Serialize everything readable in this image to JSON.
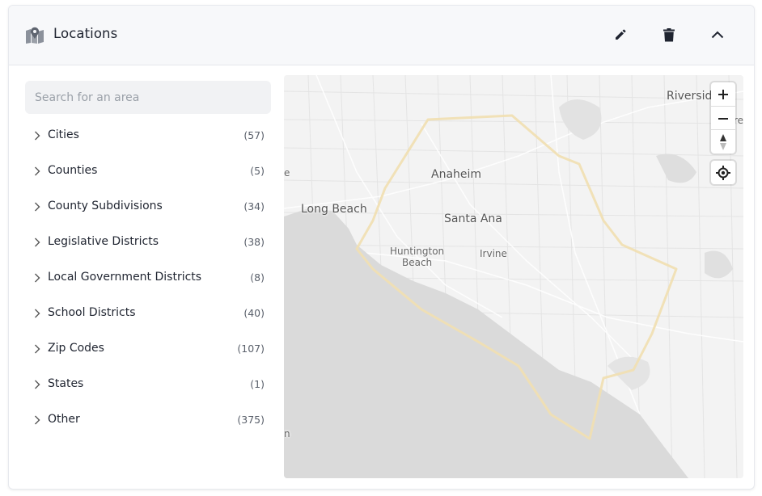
{
  "header": {
    "title": "Locations",
    "icon": "map-pin-icon",
    "actions": [
      "edit-icon",
      "trash-icon",
      "chevron-up-icon"
    ]
  },
  "search": {
    "placeholder": "Search for an area",
    "value": ""
  },
  "categories": [
    {
      "label": "Cities",
      "count": "(57)"
    },
    {
      "label": "Counties",
      "count": "(5)"
    },
    {
      "label": "County Subdivisions",
      "count": "(34)"
    },
    {
      "label": "Legislative Districts",
      "count": "(38)"
    },
    {
      "label": "Local Government Districts",
      "count": "(8)"
    },
    {
      "label": "School Districts",
      "count": "(40)"
    },
    {
      "label": "Zip Codes",
      "count": "(107)"
    },
    {
      "label": "States",
      "count": "(1)"
    },
    {
      "label": "Other",
      "count": "(375)"
    }
  ],
  "map": {
    "labels": {
      "riverside": "Riversid",
      "anaheim": "Anaheim",
      "long_beach": "Long Beach",
      "santa_ana": "Santa Ana",
      "huntington_beach_1": "Huntington",
      "huntington_beach_2": "Beach",
      "irvine": "Irvine",
      "edge_e": "e",
      "edge_re": "re",
      "edge_n": "n"
    },
    "controls": {
      "zoom_in": "+",
      "zoom_out": "−"
    },
    "boundary_color": "#f0dfb3",
    "water_color": "#dadada",
    "land_color": "#f3f3f3"
  }
}
